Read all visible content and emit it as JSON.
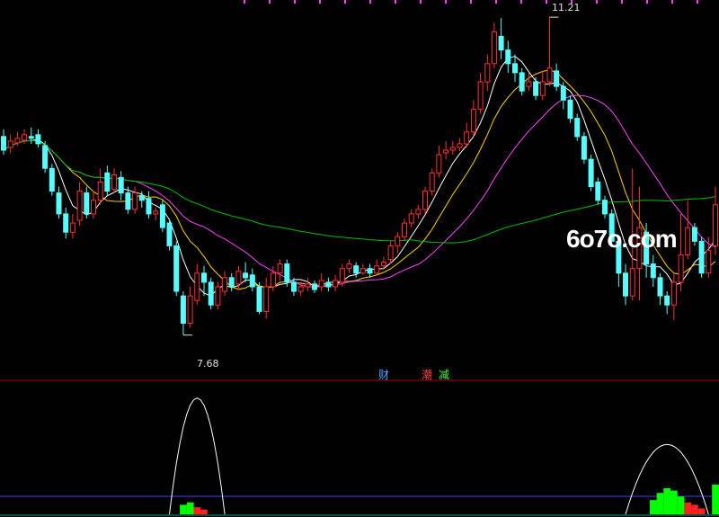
{
  "watermark": "6o7o.com",
  "price_markers": {
    "high": "11.21",
    "low": "7.68"
  },
  "indicators": [
    {
      "label": "财",
      "color": "#4da3ff"
    },
    {
      "label": "潮",
      "color": "#ff4040"
    },
    {
      "label": "减",
      "color": "#40ff40"
    }
  ],
  "colors": {
    "background": "#000000",
    "up_candle": "#ff3030",
    "down_candle": "#54ffff",
    "ma_short": "#ffffff",
    "ma_mid": "#ffd400",
    "ma_long": "#ff40ff",
    "ma_longest": "#00c000",
    "divider": "#a00000",
    "sub_line": "#4040ff",
    "sub_white": "#ffffff",
    "sub_green": "#00ff00",
    "sub_red": "#ff2020"
  },
  "chart_data": {
    "type": "candlestick",
    "y_range": [
      7.45,
      11.3
    ],
    "candles": [
      [
        9.9,
        9.75,
        9.98,
        9.7
      ],
      [
        9.78,
        9.85,
        9.92,
        9.72
      ],
      [
        9.83,
        9.88,
        9.95,
        9.8
      ],
      [
        9.86,
        9.92,
        9.98,
        9.82
      ],
      [
        9.9,
        9.88,
        10.0,
        9.82
      ],
      [
        9.92,
        9.82,
        9.98,
        9.78
      ],
      [
        9.8,
        9.55,
        9.85,
        9.5
      ],
      [
        9.55,
        9.3,
        9.6,
        9.25
      ],
      [
        9.28,
        9.05,
        9.35,
        9.0
      ],
      [
        9.05,
        8.85,
        9.12,
        8.78
      ],
      [
        8.85,
        8.95,
        9.05,
        8.78
      ],
      [
        8.98,
        9.3,
        9.4,
        8.92
      ],
      [
        9.28,
        9.05,
        9.35,
        9.0
      ],
      [
        9.05,
        9.2,
        9.3,
        9.0
      ],
      [
        9.2,
        9.4,
        9.55,
        9.15
      ],
      [
        9.5,
        9.3,
        9.58,
        9.25
      ],
      [
        9.32,
        9.48,
        9.55,
        9.28
      ],
      [
        9.45,
        9.28,
        9.52,
        9.2
      ],
      [
        9.28,
        9.1,
        9.35,
        9.05
      ],
      [
        9.1,
        9.28,
        9.35,
        9.05
      ],
      [
        9.25,
        9.2,
        9.3,
        9.12
      ],
      [
        9.22,
        9.05,
        9.3,
        9.0
      ],
      [
        9.05,
        9.08,
        9.12,
        8.98
      ],
      [
        9.15,
        8.9,
        9.2,
        8.85
      ],
      [
        8.95,
        8.7,
        9.0,
        8.65
      ],
      [
        8.7,
        8.2,
        8.75,
        8.15
      ],
      [
        8.15,
        7.85,
        8.2,
        7.72
      ],
      [
        7.85,
        8.15,
        8.25,
        7.8
      ],
      [
        8.1,
        8.4,
        8.5,
        8.05
      ],
      [
        8.4,
        8.3,
        8.48,
        8.15
      ],
      [
        8.3,
        8.05,
        8.35,
        8.0
      ],
      [
        8.05,
        8.25,
        8.3,
        8.0
      ],
      [
        8.2,
        8.35,
        8.42,
        8.15
      ],
      [
        8.35,
        8.25,
        8.4,
        8.2
      ],
      [
        8.28,
        8.42,
        8.48,
        8.22
      ],
      [
        8.4,
        8.35,
        8.52,
        8.3
      ],
      [
        8.38,
        8.25,
        8.45,
        8.2
      ],
      [
        8.25,
        7.98,
        8.3,
        7.95
      ],
      [
        7.98,
        8.25,
        8.35,
        7.9
      ],
      [
        8.25,
        8.4,
        8.48,
        8.2
      ],
      [
        8.4,
        8.5,
        8.55,
        8.32
      ],
      [
        8.5,
        8.3,
        8.55,
        8.25
      ],
      [
        8.3,
        8.2,
        8.35,
        8.15
      ],
      [
        8.2,
        8.25,
        8.3,
        8.15
      ],
      [
        8.25,
        8.28,
        8.35,
        8.2
      ],
      [
        8.28,
        8.22,
        8.32,
        8.18
      ],
      [
        8.25,
        8.32,
        8.4,
        8.2
      ],
      [
        8.3,
        8.25,
        8.35,
        8.2
      ],
      [
        8.25,
        8.32,
        8.38,
        8.2
      ],
      [
        8.3,
        8.45,
        8.5,
        8.25
      ],
      [
        8.45,
        8.5,
        8.55,
        8.4
      ],
      [
        8.48,
        8.4,
        8.52,
        8.35
      ],
      [
        8.4,
        8.45,
        8.5,
        8.38
      ],
      [
        8.45,
        8.4,
        8.5,
        8.35
      ],
      [
        8.4,
        8.48,
        8.55,
        8.38
      ],
      [
        8.48,
        8.52,
        8.58,
        8.45
      ],
      [
        8.55,
        8.7,
        8.75,
        8.5
      ],
      [
        8.7,
        8.8,
        8.85,
        8.62
      ],
      [
        8.8,
        8.95,
        9.0,
        8.75
      ],
      [
        8.95,
        9.05,
        9.1,
        8.9
      ],
      [
        9.05,
        9.1,
        9.15,
        9.0
      ],
      [
        9.1,
        9.3,
        9.35,
        9.05
      ],
      [
        9.3,
        9.5,
        9.55,
        9.25
      ],
      [
        9.5,
        9.7,
        9.8,
        9.45
      ],
      [
        9.72,
        9.75,
        9.85,
        9.65
      ],
      [
        9.75,
        9.78,
        9.85,
        9.7
      ],
      [
        9.78,
        9.82,
        9.88,
        9.74
      ],
      [
        9.82,
        9.95,
        10.05,
        9.78
      ],
      [
        9.95,
        10.2,
        10.3,
        9.9
      ],
      [
        10.2,
        10.5,
        10.6,
        10.15
      ],
      [
        10.5,
        10.7,
        10.8,
        10.4
      ],
      [
        10.7,
        11.05,
        11.15,
        10.65
      ],
      [
        11.0,
        10.85,
        11.2,
        10.75
      ],
      [
        10.85,
        10.7,
        10.95,
        10.6
      ],
      [
        10.7,
        10.6,
        10.8,
        10.5
      ],
      [
        10.6,
        10.4,
        10.65,
        10.35
      ],
      [
        10.45,
        10.5,
        10.6,
        10.4
      ],
      [
        10.5,
        10.35,
        10.55,
        10.3
      ],
      [
        10.35,
        10.5,
        10.62,
        10.3
      ],
      [
        10.5,
        10.65,
        11.21,
        10.45
      ],
      [
        10.62,
        10.45,
        10.7,
        10.4
      ],
      [
        10.45,
        10.3,
        10.5,
        10.2
      ],
      [
        10.3,
        10.1,
        10.35,
        10.05
      ],
      [
        10.1,
        9.9,
        10.15,
        9.85
      ],
      [
        9.9,
        9.65,
        9.95,
        9.6
      ],
      [
        9.65,
        9.35,
        9.7,
        9.3
      ],
      [
        9.4,
        9.2,
        9.45,
        9.15
      ],
      [
        9.2,
        9.05,
        9.25,
        9.0
      ],
      [
        9.05,
        8.75,
        9.1,
        8.7
      ],
      [
        8.75,
        8.4,
        8.8,
        8.25
      ],
      [
        8.4,
        8.15,
        8.5,
        8.05
      ],
      [
        8.15,
        8.45,
        9.55,
        8.1
      ],
      [
        8.45,
        8.9,
        9.35,
        8.1
      ],
      [
        8.85,
        8.5,
        8.95,
        8.35
      ],
      [
        8.5,
        8.35,
        8.6,
        8.25
      ],
      [
        8.35,
        8.15,
        8.4,
        8.05
      ],
      [
        8.15,
        8.05,
        8.2,
        7.95
      ],
      [
        8.05,
        8.3,
        8.4,
        7.88
      ],
      [
        8.3,
        8.6,
        9.05,
        8.2
      ],
      [
        8.6,
        8.9,
        9.2,
        8.55
      ],
      [
        8.9,
        8.75,
        8.95,
        8.7
      ],
      [
        8.75,
        8.4,
        8.8,
        8.35
      ],
      [
        8.4,
        8.65,
        8.8,
        8.35
      ],
      [
        8.7,
        9.15,
        9.35,
        8.6
      ]
    ],
    "overlays": [
      {
        "name": "MA5",
        "color": "#ffffff"
      },
      {
        "name": "MA10",
        "color": "#ffd400"
      },
      {
        "name": "MA20",
        "color": "#ff40ff"
      },
      {
        "name": "MA60",
        "color": "#00c000"
      }
    ],
    "sub_indicator": {
      "white_peaks": [
        {
          "center_index": 28,
          "peak": 1.0,
          "width": 4
        },
        {
          "center_index": 96,
          "peak": 0.6,
          "width": 6
        },
        {
          "center_index": 106,
          "peak": 0.25,
          "width": 3
        }
      ],
      "green_bars": [
        {
          "index": 26,
          "value": 0.08
        },
        {
          "index": 27,
          "value": 0.1
        },
        {
          "index": 94,
          "value": 0.12
        },
        {
          "index": 95,
          "value": 0.18
        },
        {
          "index": 96,
          "value": 0.22
        },
        {
          "index": 97,
          "value": 0.2
        },
        {
          "index": 98,
          "value": 0.15
        },
        {
          "index": 103,
          "value": 0.25
        },
        {
          "index": 104,
          "value": 0.22
        }
      ],
      "red_bars": [
        {
          "index": 28,
          "value": 0.06
        },
        {
          "index": 29,
          "value": 0.04
        },
        {
          "index": 99,
          "value": 0.1
        },
        {
          "index": 100,
          "value": 0.08
        },
        {
          "index": 101,
          "value": 0.05
        },
        {
          "index": 105,
          "value": 0.15
        },
        {
          "index": 106,
          "value": 0.12
        },
        {
          "index": 107,
          "value": 0.08
        }
      ]
    }
  }
}
